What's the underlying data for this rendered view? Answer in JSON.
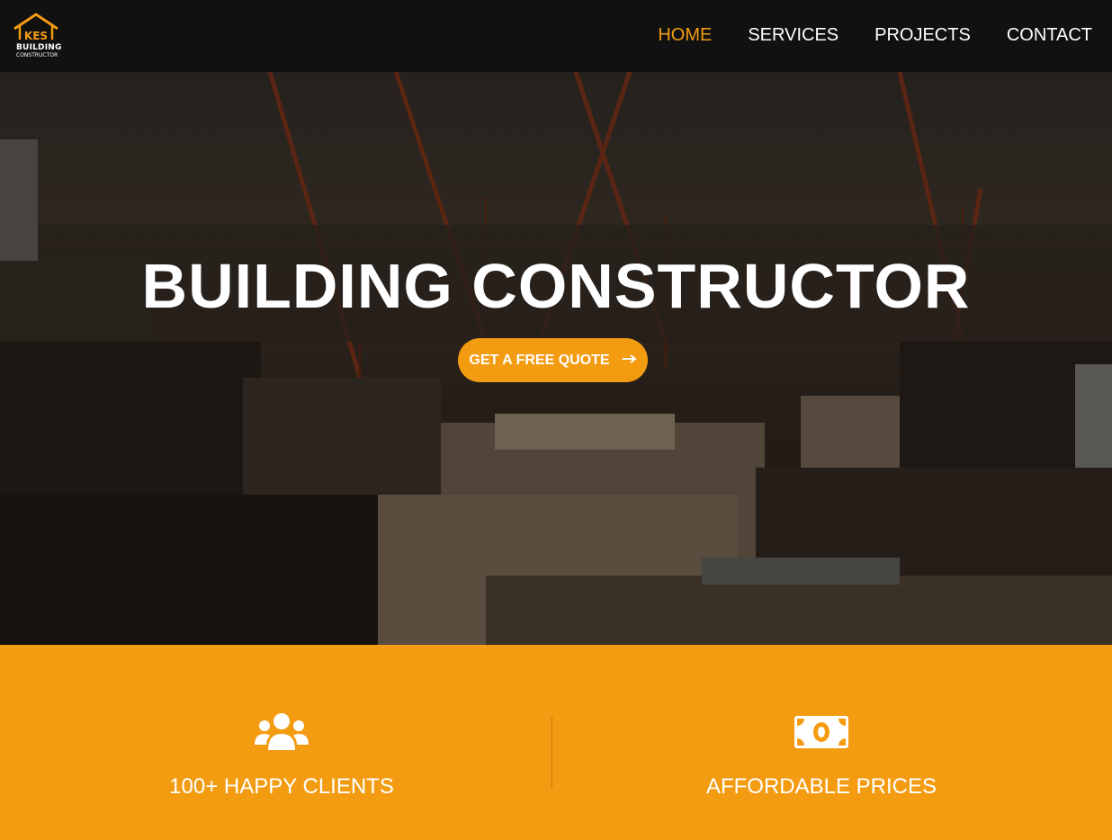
{
  "logo": {
    "letters": "KES",
    "line1": "BUILDING",
    "line2": "CONSTRUCTOR"
  },
  "nav": {
    "items": [
      {
        "label": "HOME",
        "active": true
      },
      {
        "label": "SERVICES",
        "active": false
      },
      {
        "label": "PROJECTS",
        "active": false
      },
      {
        "label": "CONTACT",
        "active": false
      }
    ]
  },
  "hero": {
    "title": "BUILDING CONSTRUCTOR",
    "cta_label": "GET A FREE QUOTE",
    "cta_icon": "arrow-right-icon"
  },
  "features": [
    {
      "icon": "users-icon",
      "label": "100+ HAPPY CLIENTS"
    },
    {
      "icon": "money-bill-icon",
      "label": "AFFORDABLE PRICES"
    }
  ],
  "colors": {
    "accent": "#f39c12",
    "nav_bg": "#111111",
    "text": "#ffffff"
  }
}
